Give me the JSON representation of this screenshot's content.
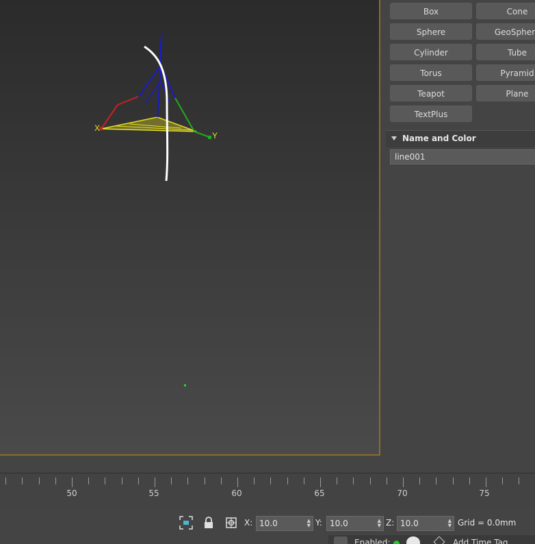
{
  "create_panel": {
    "buttons": [
      "Box",
      "Cone",
      "Sphere",
      "GeoSphere",
      "Cylinder",
      "Tube",
      "Torus",
      "Pyramid",
      "Teapot",
      "Plane",
      "TextPlus"
    ],
    "name_and_color": {
      "title": "Name and Color",
      "name_value": "line001"
    }
  },
  "viewport": {
    "axis_labels": {
      "x": "X",
      "y": "Y",
      "z": "Z"
    },
    "colors": {
      "x_axis": "#cc2020",
      "y_axis": "#22aa22",
      "z_axis": "#1a1acc",
      "selection": "#e8e020",
      "spline": "#ffffff",
      "border": "#8a6e2b"
    }
  },
  "timeline": {
    "labels": [
      "50",
      "55",
      "60",
      "65",
      "70",
      "75"
    ]
  },
  "status_bar": {
    "x_label": "X:",
    "x_value": "10.0",
    "y_label": "Y:",
    "y_value": "10.0",
    "z_label": "Z:",
    "z_value": "10.0",
    "grid_text": "Grid = 0.0mm",
    "enabled_label": "Enabled:",
    "add_time_tag": "Add Time Tag"
  }
}
